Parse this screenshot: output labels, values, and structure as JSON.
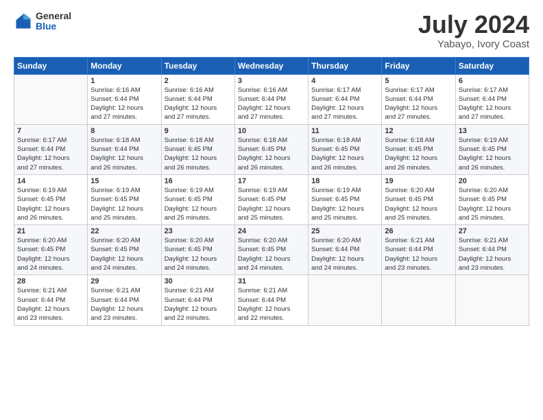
{
  "logo": {
    "general": "General",
    "blue": "Blue"
  },
  "title": "July 2024",
  "subtitle": "Yabayo, Ivory Coast",
  "weekdays": [
    "Sunday",
    "Monday",
    "Tuesday",
    "Wednesday",
    "Thursday",
    "Friday",
    "Saturday"
  ],
  "weeks": [
    [
      {
        "day": "",
        "info": ""
      },
      {
        "day": "1",
        "info": "Sunrise: 6:16 AM\nSunset: 6:44 PM\nDaylight: 12 hours\nand 27 minutes."
      },
      {
        "day": "2",
        "info": "Sunrise: 6:16 AM\nSunset: 6:44 PM\nDaylight: 12 hours\nand 27 minutes."
      },
      {
        "day": "3",
        "info": "Sunrise: 6:16 AM\nSunset: 6:44 PM\nDaylight: 12 hours\nand 27 minutes."
      },
      {
        "day": "4",
        "info": "Sunrise: 6:17 AM\nSunset: 6:44 PM\nDaylight: 12 hours\nand 27 minutes."
      },
      {
        "day": "5",
        "info": "Sunrise: 6:17 AM\nSunset: 6:44 PM\nDaylight: 12 hours\nand 27 minutes."
      },
      {
        "day": "6",
        "info": "Sunrise: 6:17 AM\nSunset: 6:44 PM\nDaylight: 12 hours\nand 27 minutes."
      }
    ],
    [
      {
        "day": "7",
        "info": "Sunrise: 6:17 AM\nSunset: 6:44 PM\nDaylight: 12 hours\nand 27 minutes."
      },
      {
        "day": "8",
        "info": "Sunrise: 6:18 AM\nSunset: 6:44 PM\nDaylight: 12 hours\nand 26 minutes."
      },
      {
        "day": "9",
        "info": "Sunrise: 6:18 AM\nSunset: 6:45 PM\nDaylight: 12 hours\nand 26 minutes."
      },
      {
        "day": "10",
        "info": "Sunrise: 6:18 AM\nSunset: 6:45 PM\nDaylight: 12 hours\nand 26 minutes."
      },
      {
        "day": "11",
        "info": "Sunrise: 6:18 AM\nSunset: 6:45 PM\nDaylight: 12 hours\nand 26 minutes."
      },
      {
        "day": "12",
        "info": "Sunrise: 6:18 AM\nSunset: 6:45 PM\nDaylight: 12 hours\nand 26 minutes."
      },
      {
        "day": "13",
        "info": "Sunrise: 6:19 AM\nSunset: 6:45 PM\nDaylight: 12 hours\nand 26 minutes."
      }
    ],
    [
      {
        "day": "14",
        "info": "Sunrise: 6:19 AM\nSunset: 6:45 PM\nDaylight: 12 hours\nand 26 minutes."
      },
      {
        "day": "15",
        "info": "Sunrise: 6:19 AM\nSunset: 6:45 PM\nDaylight: 12 hours\nand 25 minutes."
      },
      {
        "day": "16",
        "info": "Sunrise: 6:19 AM\nSunset: 6:45 PM\nDaylight: 12 hours\nand 25 minutes."
      },
      {
        "day": "17",
        "info": "Sunrise: 6:19 AM\nSunset: 6:45 PM\nDaylight: 12 hours\nand 25 minutes."
      },
      {
        "day": "18",
        "info": "Sunrise: 6:19 AM\nSunset: 6:45 PM\nDaylight: 12 hours\nand 25 minutes."
      },
      {
        "day": "19",
        "info": "Sunrise: 6:20 AM\nSunset: 6:45 PM\nDaylight: 12 hours\nand 25 minutes."
      },
      {
        "day": "20",
        "info": "Sunrise: 6:20 AM\nSunset: 6:45 PM\nDaylight: 12 hours\nand 25 minutes."
      }
    ],
    [
      {
        "day": "21",
        "info": "Sunrise: 6:20 AM\nSunset: 6:45 PM\nDaylight: 12 hours\nand 24 minutes."
      },
      {
        "day": "22",
        "info": "Sunrise: 6:20 AM\nSunset: 6:45 PM\nDaylight: 12 hours\nand 24 minutes."
      },
      {
        "day": "23",
        "info": "Sunrise: 6:20 AM\nSunset: 6:45 PM\nDaylight: 12 hours\nand 24 minutes."
      },
      {
        "day": "24",
        "info": "Sunrise: 6:20 AM\nSunset: 6:45 PM\nDaylight: 12 hours\nand 24 minutes."
      },
      {
        "day": "25",
        "info": "Sunrise: 6:20 AM\nSunset: 6:44 PM\nDaylight: 12 hours\nand 24 minutes."
      },
      {
        "day": "26",
        "info": "Sunrise: 6:21 AM\nSunset: 6:44 PM\nDaylight: 12 hours\nand 23 minutes."
      },
      {
        "day": "27",
        "info": "Sunrise: 6:21 AM\nSunset: 6:44 PM\nDaylight: 12 hours\nand 23 minutes."
      }
    ],
    [
      {
        "day": "28",
        "info": "Sunrise: 6:21 AM\nSunset: 6:44 PM\nDaylight: 12 hours\nand 23 minutes."
      },
      {
        "day": "29",
        "info": "Sunrise: 6:21 AM\nSunset: 6:44 PM\nDaylight: 12 hours\nand 23 minutes."
      },
      {
        "day": "30",
        "info": "Sunrise: 6:21 AM\nSunset: 6:44 PM\nDaylight: 12 hours\nand 22 minutes."
      },
      {
        "day": "31",
        "info": "Sunrise: 6:21 AM\nSunset: 6:44 PM\nDaylight: 12 hours\nand 22 minutes."
      },
      {
        "day": "",
        "info": ""
      },
      {
        "day": "",
        "info": ""
      },
      {
        "day": "",
        "info": ""
      }
    ]
  ]
}
